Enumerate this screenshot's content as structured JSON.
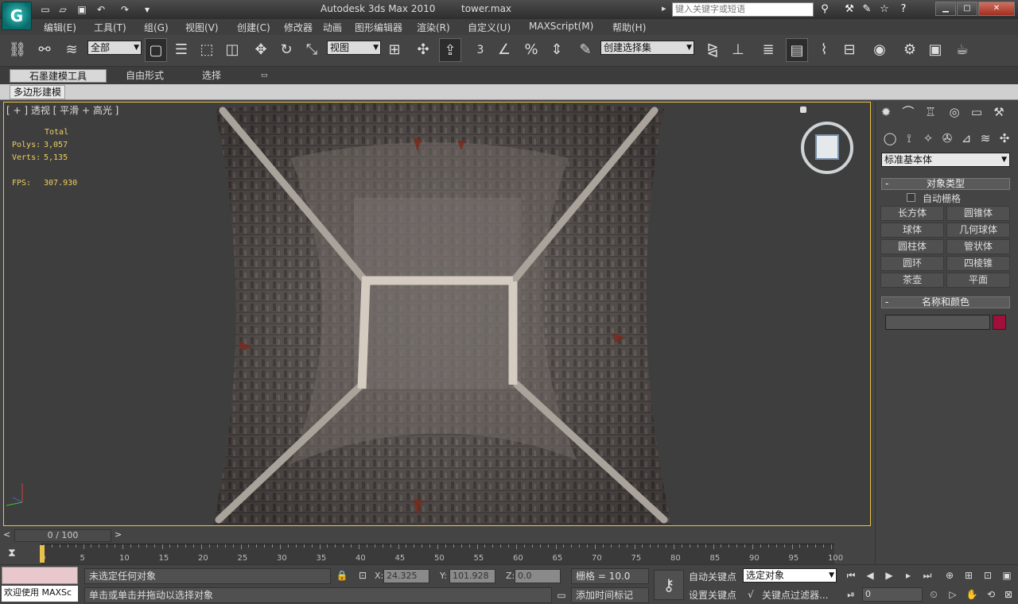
{
  "app": {
    "title": "Autodesk 3ds Max  2010",
    "file": "tower.max",
    "logo": "G"
  },
  "search": {
    "placeholder": "键入关键字或短语"
  },
  "menu": [
    "编辑(E)",
    "工具(T)",
    "组(G)",
    "视图(V)",
    "创建(C)",
    "修改器",
    "动画",
    "图形编辑器",
    "渲染(R)",
    "自定义(U)",
    "MAXScript(M)",
    "帮助(H)"
  ],
  "toolbar": {
    "selection_filter": "全部",
    "ref_coord": "视图",
    "named_sel": "创建选择集",
    "snap_label": "3"
  },
  "ribbon": {
    "tabs": [
      "石墨建模工具",
      "自由形式",
      "选择"
    ],
    "subtab": "多边形建模"
  },
  "viewport": {
    "label": "[ + ] 透视 [ 平滑 + 高光 ]",
    "stats": {
      "header": "Total",
      "polys_label": "Polys:",
      "polys": "3,057",
      "verts_label": "Verts:",
      "verts": "5,135",
      "fps_label": "FPS:",
      "fps": "307.930"
    }
  },
  "panel": {
    "category": "标准基本体",
    "rollout_object_type": "对象类型",
    "autogrid": "自动栅格",
    "objects": [
      "长方体",
      "圆锥体",
      "球体",
      "几何球体",
      "圆柱体",
      "管状体",
      "圆环",
      "四棱锥",
      "茶壶",
      "平面"
    ],
    "rollout_name_color": "名称和颜色",
    "object_color": "#a0103a"
  },
  "timeline": {
    "slider": "0 / 100",
    "ticks": [
      "0",
      "5",
      "10",
      "15",
      "20",
      "25",
      "30",
      "35",
      "40",
      "45",
      "50",
      "55",
      "60",
      "65",
      "70",
      "75",
      "80",
      "85",
      "90",
      "95",
      "100"
    ]
  },
  "status": {
    "welcome": "欢迎使用 MAXSc",
    "selection": "未选定任何对象",
    "prompt": "单击或单击并拖动以选择对象",
    "x_label": "X:",
    "x": "24.325",
    "y_label": "Y:",
    "y": "101.928",
    "z_label": "Z:",
    "z": "0.0",
    "grid": "栅格 = 10.0",
    "add_time_tag": "添加时间标记",
    "auto_key": "自动关键点",
    "set_key": "设置关键点",
    "key_mode": "选定对象",
    "key_filters": "关键点过滤器...",
    "frame": "0"
  }
}
